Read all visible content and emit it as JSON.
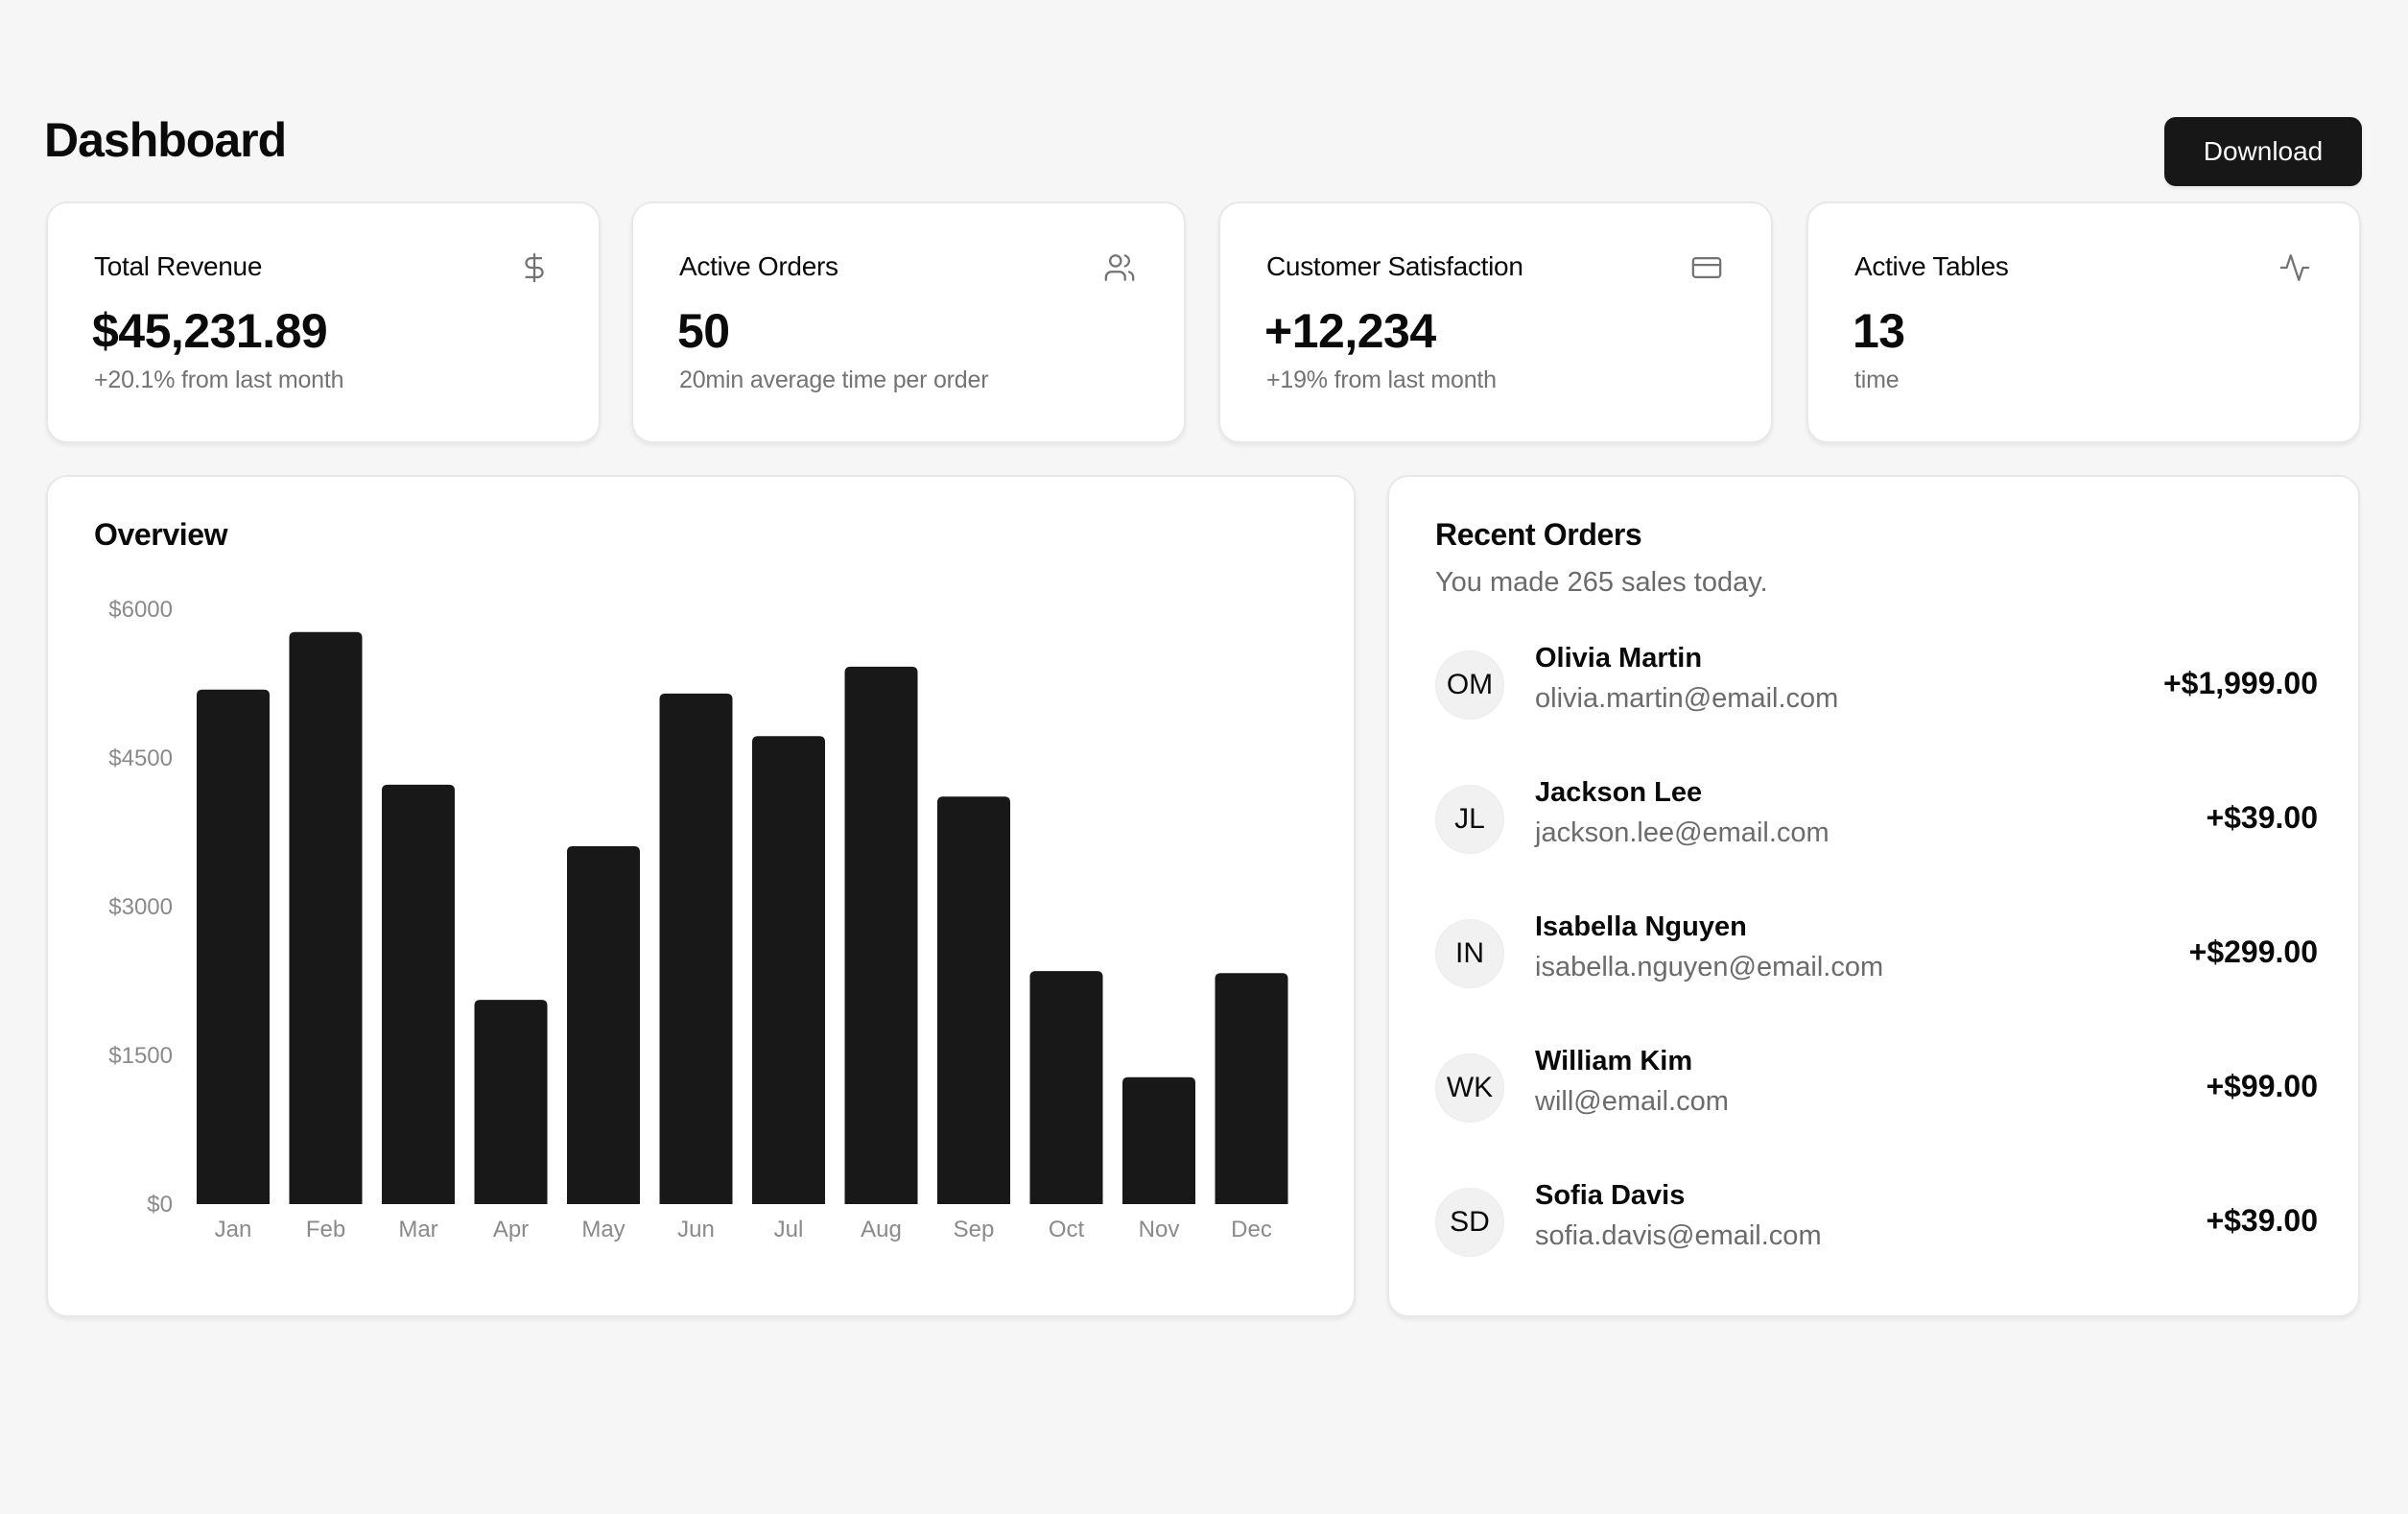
{
  "header": {
    "title": "Dashboard",
    "download_label": "Download"
  },
  "kpis": [
    {
      "title": "Total Revenue",
      "value": "$45,231.89",
      "sub": "+20.1% from last month",
      "icon": "dollar-sign-icon"
    },
    {
      "title": "Active Orders",
      "value": "50",
      "sub": "20min average time per order",
      "icon": "users-icon"
    },
    {
      "title": "Customer Satisfaction",
      "value": "+12,234",
      "sub": "+19% from last month",
      "icon": "credit-card-icon"
    },
    {
      "title": "Active Tables",
      "value": "13",
      "sub": "time",
      "icon": "activity-icon"
    }
  ],
  "overview": {
    "title": "Overview"
  },
  "chart_data": {
    "type": "bar",
    "title": "Overview",
    "xlabel": "",
    "ylabel": "",
    "categories": [
      "Jan",
      "Feb",
      "Mar",
      "Apr",
      "May",
      "Jun",
      "Jul",
      "Aug",
      "Sep",
      "Oct",
      "Nov",
      "Dec"
    ],
    "values": [
      5190,
      5770,
      4230,
      2060,
      3610,
      5150,
      4720,
      5420,
      4110,
      2350,
      1280,
      2330
    ],
    "yticks": [
      0,
      1500,
      3000,
      4500,
      6000
    ],
    "ytick_labels": [
      "$0",
      "$1500",
      "$3000",
      "$4500",
      "$6000"
    ],
    "ylim": [
      0,
      6000
    ],
    "grid": false,
    "legend": "none",
    "bar_color": "#181818"
  },
  "recent_orders": {
    "title": "Recent Orders",
    "subtitle": "You made 265 sales today.",
    "items": [
      {
        "initials": "OM",
        "name": "Olivia Martin",
        "email": "olivia.martin@email.com",
        "amount": "+$1,999.00"
      },
      {
        "initials": "JL",
        "name": "Jackson Lee",
        "email": "jackson.lee@email.com",
        "amount": "+$39.00"
      },
      {
        "initials": "IN",
        "name": "Isabella Nguyen",
        "email": "isabella.nguyen@email.com",
        "amount": "+$299.00"
      },
      {
        "initials": "WK",
        "name": "William Kim",
        "email": "will@email.com",
        "amount": "+$99.00"
      },
      {
        "initials": "SD",
        "name": "Sofia Davis",
        "email": "sofia.davis@email.com",
        "amount": "+$39.00"
      }
    ]
  }
}
